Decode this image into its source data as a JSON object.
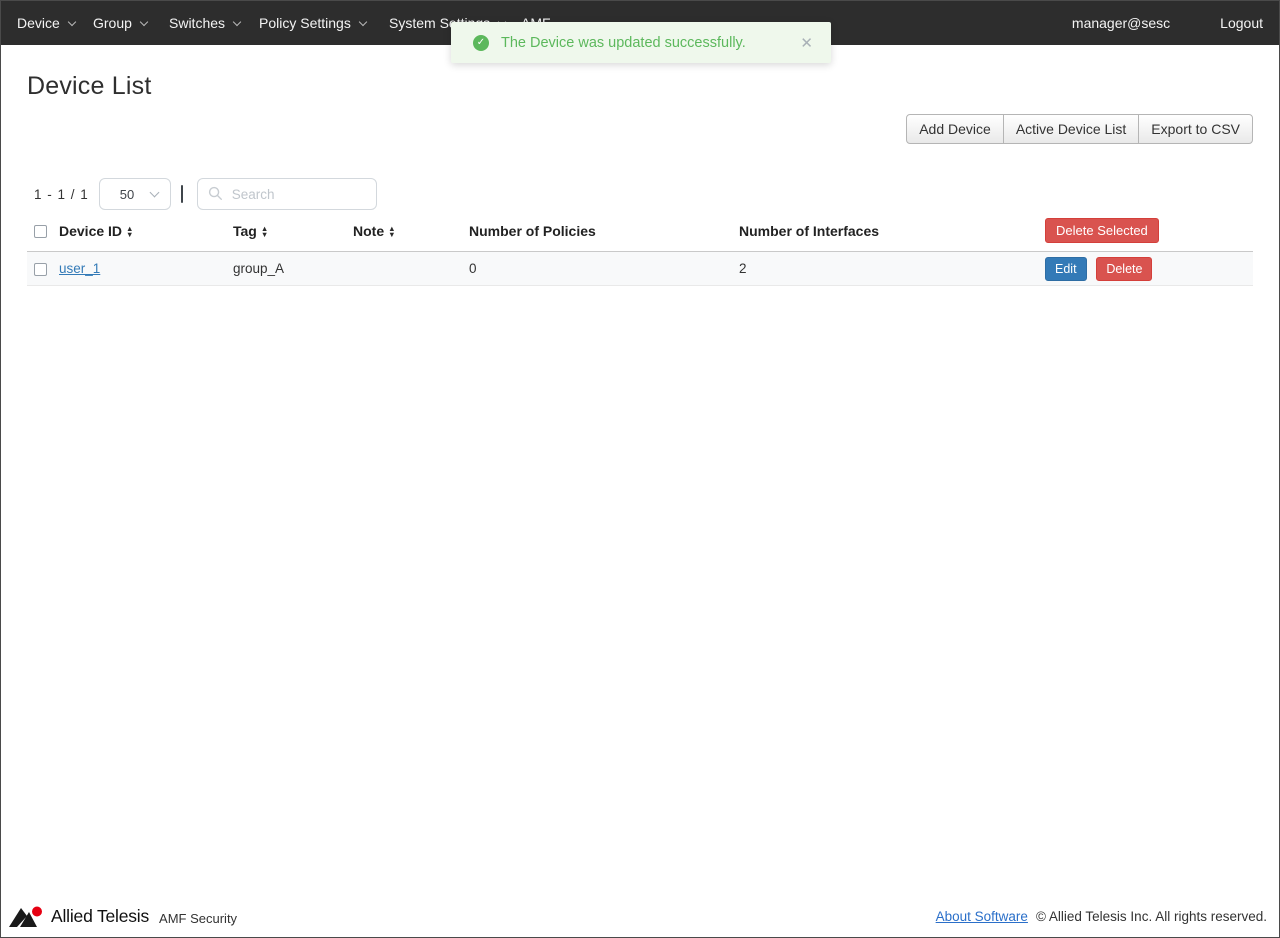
{
  "navbar": {
    "items": [
      {
        "label": "Device",
        "has_caret": true
      },
      {
        "label": "Group",
        "has_caret": true
      },
      {
        "label": "Switches",
        "has_caret": true
      },
      {
        "label": "Policy Settings",
        "has_caret": true
      },
      {
        "label": "System Settings",
        "has_caret": true
      },
      {
        "label": "AMF",
        "has_caret": false
      }
    ],
    "user": "manager@sesc",
    "logout_label": "Logout"
  },
  "toast": {
    "message": "The Device was updated successfully."
  },
  "icons": {
    "check": "✓",
    "close": "✕",
    "sort_up": "▲",
    "sort_down": "▼"
  },
  "page": {
    "title": "Device List"
  },
  "toolbar": {
    "buttons": [
      "Add Device",
      "Active Device List",
      "Export to CSV"
    ]
  },
  "list_controls": {
    "range": "1 - 1 / 1",
    "page_size": "50",
    "search_placeholder": "Search"
  },
  "table": {
    "headers": [
      {
        "label": "Device ID",
        "sortable": true
      },
      {
        "label": "Tag",
        "sortable": true
      },
      {
        "label": "Note",
        "sortable": true
      },
      {
        "label": "Number of Policies",
        "sortable": false
      },
      {
        "label": "Number of Interfaces",
        "sortable": false
      }
    ],
    "delete_selected_label": "Delete Selected",
    "rows": [
      {
        "device_id": "user_1",
        "tag": "group_A",
        "note": "",
        "policies": "0",
        "interfaces": "2",
        "actions": [
          "Edit",
          "Delete"
        ]
      }
    ]
  },
  "footer": {
    "brand": "Allied Telesis",
    "product": "AMF Security",
    "about_link": "About Software",
    "copyright": "© Allied Telesis Inc. All rights reserved."
  },
  "colors": {
    "navbar_bg": "#2d2d2d",
    "success_green": "#5cb85c",
    "toast_bg": "#eff8ec",
    "primary_blue": "#337ab7",
    "danger_red": "#d9534f",
    "link_blue": "#2a6fc9"
  }
}
